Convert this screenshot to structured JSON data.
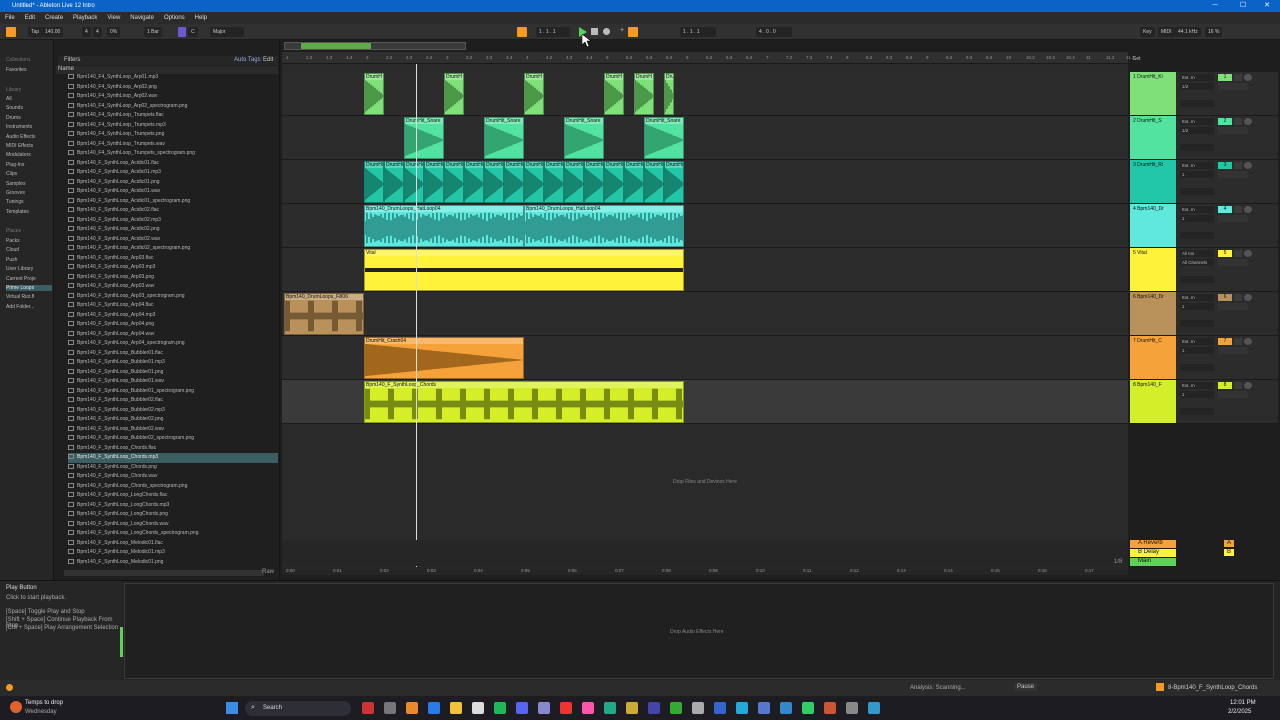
{
  "window": {
    "title": "Untitled* - Ableton Live 12 Intro",
    "min": "─",
    "max": "☐",
    "close": "✕"
  },
  "menu": [
    "File",
    "Edit",
    "Create",
    "Playback",
    "View",
    "Navigate",
    "Options",
    "Help"
  ],
  "transport": {
    "tap": "Tap",
    "tempo": "140.00",
    "sig_num": "4",
    "sig_den": "4",
    "metro": "0%",
    "quant": "1 Bar",
    "key": "C",
    "scale": "Major",
    "pos1": "1 . 1 . 1",
    "pos2": "1 . 1 . 1",
    "loop": "4 . 0 . 0",
    "key_label": "Key",
    "midi_label": "MIDI",
    "sr": "44.1 kHz",
    "cpu": "16 %"
  },
  "colors": {
    "green": "#7fe07a",
    "mint": "#53e3a0",
    "teal": "#22c7a8",
    "cyan": "#5fe8dc",
    "yellow": "#fff23a",
    "tan": "#b8925a",
    "orange": "#f5a23a",
    "lime": "#d4ef2a",
    "accent": "#f59a23"
  },
  "leftnav": {
    "collections_head": "Collections",
    "favorites": "Favorites",
    "library_head": "Library",
    "items": [
      "All",
      "Sounds",
      "Drums",
      "Instruments",
      "Audio Effects",
      "MIDI Effects",
      "Modulators",
      "Plug-Ins",
      "Clips",
      "Samples",
      "Grooves",
      "Tunings",
      "Templates"
    ],
    "places_head": "Places",
    "places": [
      "Packs",
      "Cloud",
      "Push",
      "User Library",
      "Current Proje",
      "Prime Loops",
      "Virtual Riot.fl",
      "Add Folder..."
    ]
  },
  "browser": {
    "filters": "Filters",
    "autotag": "Auto Tags",
    "edit": "Edit",
    "name_col": "Name",
    "files": [
      "Bpm140_F4_SynthLoop_Arp01.mp3",
      "Bpm140_F4_SynthLoop_Arp02.png",
      "Bpm140_F4_SynthLoop_Arp02.wav",
      "Bpm140_F4_SynthLoop_Arp02_spectrogram.png",
      "Bpm140_F4_SynthLoop_Trumpets.flac",
      "Bpm140_F4_SynthLoop_Trumpets.mp3",
      "Bpm140_F4_SynthLoop_Trumpets.png",
      "Bpm140_F4_SynthLoop_Trumpets.wav",
      "Bpm140_F4_SynthLoop_Trumpets_spectrogram.png",
      "Bpm140_F_SynthLoop_Acidic01.flac",
      "Bpm140_F_SynthLoop_Acidic01.mp3",
      "Bpm140_F_SynthLoop_Acidic01.png",
      "Bpm140_F_SynthLoop_Acidic01.wav",
      "Bpm140_F_SynthLoop_Acidic01_spectrogram.png",
      "Bpm140_F_SynthLoop_Acidic02.flac",
      "Bpm140_F_SynthLoop_Acidic02.mp3",
      "Bpm140_F_SynthLoop_Acidic02.png",
      "Bpm140_F_SynthLoop_Acidic02.wav",
      "Bpm140_F_SynthLoop_Acidic02_spectrogram.png",
      "Bpm140_F_SynthLoop_Arp03.flac",
      "Bpm140_F_SynthLoop_Arp03.mp3",
      "Bpm140_F_SynthLoop_Arp03.png",
      "Bpm140_F_SynthLoop_Arp03.wav",
      "Bpm140_F_SynthLoop_Arp03_spectrogram.png",
      "Bpm140_F_SynthLoop_Arp04.flac",
      "Bpm140_F_SynthLoop_Arp04.mp3",
      "Bpm140_F_SynthLoop_Arp04.png",
      "Bpm140_F_SynthLoop_Arp04.wav",
      "Bpm140_F_SynthLoop_Arp04_spectrogram.png",
      "Bpm140_F_SynthLoop_Bubbler01.flac",
      "Bpm140_F_SynthLoop_Bubbler01.mp3",
      "Bpm140_F_SynthLoop_Bubbler01.png",
      "Bpm140_F_SynthLoop_Bubbler01.wav",
      "Bpm140_F_SynthLoop_Bubbler01_spectrogram.png",
      "Bpm140_F_SynthLoop_Bubbler02.flac",
      "Bpm140_F_SynthLoop_Bubbler02.mp3",
      "Bpm140_F_SynthLoop_Bubbler02.png",
      "Bpm140_F_SynthLoop_Bubbler02.wav",
      "Bpm140_F_SynthLoop_Bubbler02_spectrogram.png",
      "Bpm140_F_SynthLoop_Chords.flac",
      "Bpm140_F_SynthLoop_Chords.mp3",
      "Bpm140_F_SynthLoop_Chords.png",
      "Bpm140_F_SynthLoop_Chords.wav",
      "Bpm140_F_SynthLoop_Chords_spectrogram.png",
      "Bpm140_F_SynthLoop_LongChords.flac",
      "Bpm140_F_SynthLoop_LongChords.mp3",
      "Bpm140_F_SynthLoop_LongChords.png",
      "Bpm140_F_SynthLoop_LongChords.wav",
      "Bpm140_F_SynthLoop_LongChords_spectrogram.png",
      "Bpm140_F_SynthLoop_Melodic01.flac",
      "Bpm140_F_SynthLoop_Melodic01.mp3",
      "Bpm140_F_SynthLoop_Melodic01.png"
    ],
    "selected_index": 40,
    "raw": "Raw"
  },
  "ruler_bars": [
    "1",
    "1.2",
    "1.3",
    "1.4",
    "2",
    "2.2",
    "2.3",
    "2.4",
    "3",
    "3.2",
    "3.3",
    "3.4",
    "4",
    "4.2",
    "4.3",
    "4.4",
    "5",
    "5.2",
    "5.3",
    "5.4",
    "6",
    "6.2",
    "6.3",
    "6.4",
    "7",
    "7.2",
    "7.3",
    "7.4",
    "8",
    "8.2",
    "8.3",
    "8.4",
    "9",
    "9.2",
    "9.3",
    "9.4",
    "10",
    "10.2",
    "10.3",
    "10.4",
    "11",
    "11.2",
    "11.3"
  ],
  "time_ruler": [
    "0:00",
    "0:01",
    "0:02",
    "0:03",
    "0:04",
    "0:05",
    "0:06",
    "0:07",
    "0:08",
    "0:09",
    "0:10",
    "0:11",
    "0:12",
    "0:13",
    "0:14",
    "0:15",
    "0:16",
    "0:17"
  ],
  "tracks": [
    {
      "name": "1 DrumHit_Ki",
      "color": "#7fe07a",
      "input": "Ext. In",
      "ch": "1/2",
      "num": "1"
    },
    {
      "name": "2 DrumHit_S",
      "color": "#53e3a0",
      "input": "Ext. In",
      "ch": "1/2",
      "num": "2"
    },
    {
      "name": "3 DrumHit_Ri",
      "color": "#22c7a8",
      "input": "Ext. In",
      "ch": "1",
      "num": "3"
    },
    {
      "name": "4 Bpm140_Dr",
      "color": "#5fe8dc",
      "input": "Ext. In",
      "ch": "1",
      "num": "4"
    },
    {
      "name": "5 Vital",
      "color": "#fff23a",
      "input": "All Ins",
      "ch": "All Channels",
      "num": "5"
    },
    {
      "name": "6 Bpm140_Dr",
      "color": "#b8925a",
      "input": "Ext. In",
      "ch": "1",
      "num": "6"
    },
    {
      "name": "7 DrumHit_C",
      "color": "#f5a23a",
      "input": "Ext. In",
      "ch": "1",
      "num": "7"
    },
    {
      "name": "8 Bpm140_F",
      "color": "#d4ef2a",
      "input": "Ext. In",
      "ch": "1",
      "num": "8"
    }
  ],
  "clips": {
    "kick": "DrumH",
    "snare": "DrumHit_Snare",
    "ride": "DrumHi",
    "hat1": "Bpm140_DrumLoops_HatLoop04",
    "hat2": "Bpm140_DrumLoops_HatLoop04",
    "vital": "Vital",
    "fill": "Bpm140_DrumLoops_Fill06",
    "crash": "DrumHit_Crash04",
    "chords": "Bpm140_F_SynthLoop_Chords"
  },
  "returns": [
    {
      "name": "A Reverb",
      "letter": "A"
    },
    {
      "name": "B Delay",
      "letter": "B"
    },
    {
      "name": "Main",
      "letter": ""
    }
  ],
  "arrangement": {
    "drop_text": "Drop Files and Devices Here",
    "zoom": "1/8"
  },
  "info": {
    "title": "Play Button",
    "desc": "Click to start playback.",
    "line1": "[Space] Toggle Play and Stop",
    "line2": "[Shift + Space] Continue Playback From Stop",
    "line3": "[Ctrl + Space] Play Arrangement Selection"
  },
  "detail": {
    "drop_text": "Drop Audio Effects Here"
  },
  "status": {
    "analysis": "Analysis: Scanning...",
    "pause": "Pause",
    "clip": "8-Bpm140_F_SynthLoop_Chords"
  },
  "taskbar": {
    "weather": "Temps to drop",
    "weather_sub": "Wednesday",
    "search": "Search",
    "time": "12:01 PM",
    "date": "2/2/2025"
  }
}
